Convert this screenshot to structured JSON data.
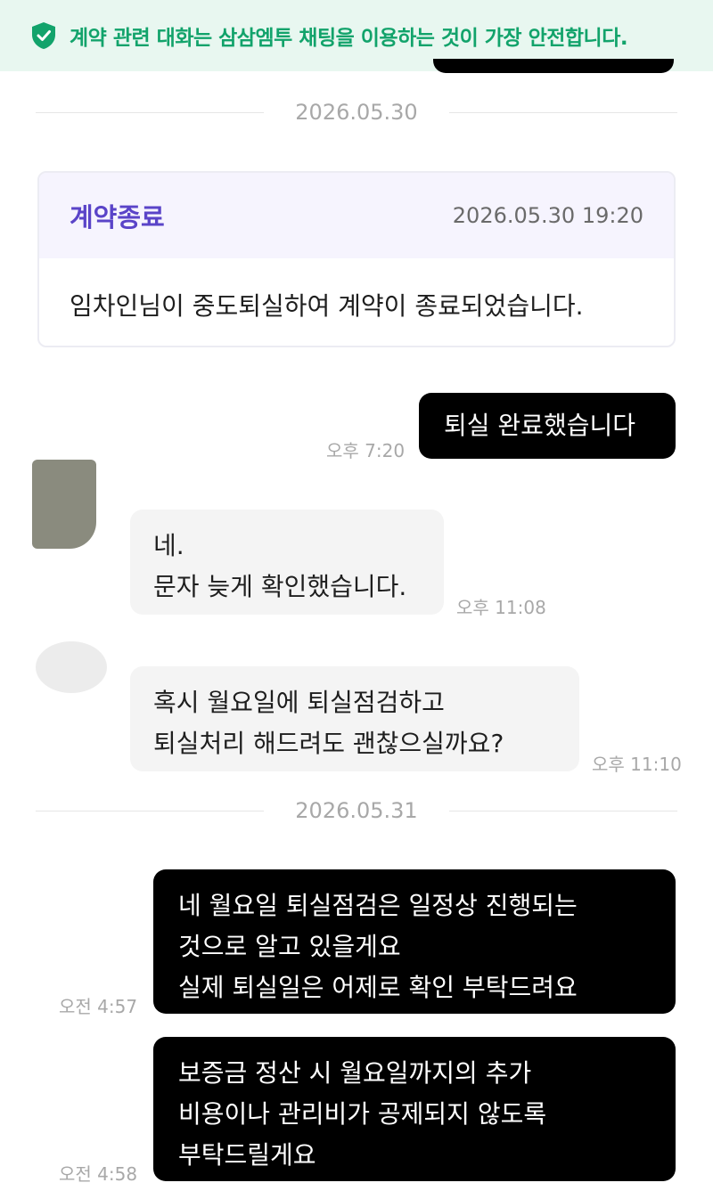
{
  "banner": {
    "icon": "shield-check-icon",
    "text": "계약 관련 대화는 삼삼엠투 채팅을 이용하는 것이 가장 안전합니다.",
    "color": "#12a36b",
    "background": "#e8f7f0"
  },
  "dates": {
    "first": "2026.05.30",
    "second": "2026.05.31"
  },
  "contract_card": {
    "title": "계약종료",
    "timestamp": "2026.05.30 19:20",
    "body": "임차인님이 중도퇴실하여 계약이 종료되었습니다.",
    "title_color": "#5a44c8"
  },
  "messages": [
    {
      "sender": "me",
      "lines": [
        "퇴실 완료했습니다"
      ],
      "time": "오후 7:20"
    },
    {
      "sender": "other",
      "lines": [
        "네.",
        "문자 늦게 확인했습니다."
      ],
      "time": "오후 11:08"
    },
    {
      "sender": "other",
      "lines": [
        "혹시 월요일에 퇴실점검하고",
        "퇴실처리 해드려도 괜찮으실까요?"
      ],
      "time": "오후 11:10"
    },
    {
      "sender": "me",
      "lines": [
        "네 월요일 퇴실점검은 일정상 진행되는",
        "것으로 알고 있을게요",
        "실제 퇴실일은 어제로 확인 부탁드려요"
      ],
      "time": "오전 4:57"
    },
    {
      "sender": "me",
      "lines": [
        "보증금 정산 시 월요일까지의 추가",
        "비용이나 관리비가 공제되지 않도록",
        "부탁드릴게요"
      ],
      "time": "오전 4:58"
    }
  ]
}
